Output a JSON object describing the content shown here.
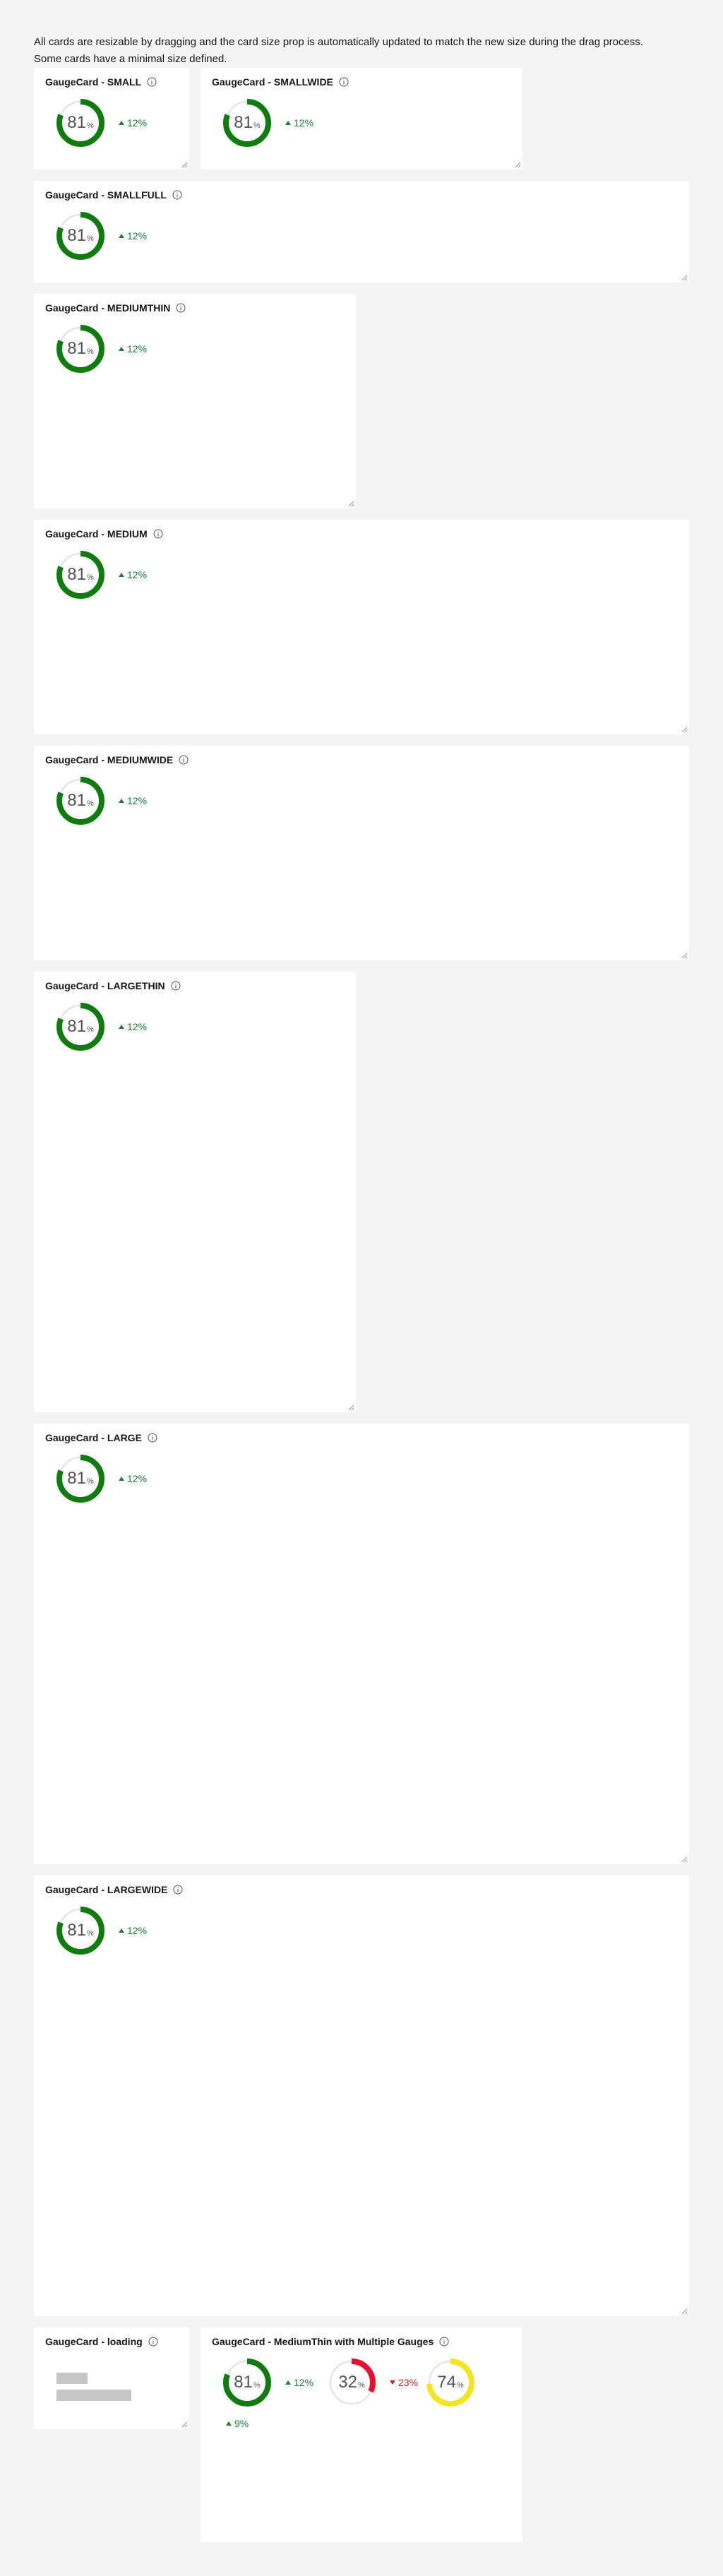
{
  "intro": "All cards are resizable by dragging and the card size prop is automatically updated to match the new size during the drag process. Some cards have a minimal size defined.",
  "colors": {
    "good": "#0e7d0e",
    "bad": "#da1e28",
    "warn": "#f1e32a",
    "track": "#e0e0e0"
  },
  "cards": {
    "small": {
      "title": "GaugeCard - SMALL",
      "gauge": {
        "value": "81",
        "unit": "%",
        "fraction": 0.81,
        "color": "#107c10"
      },
      "trend": "12%"
    },
    "smallwide": {
      "title": "GaugeCard - SMALLWIDE",
      "gauge": {
        "value": "81",
        "unit": "%",
        "fraction": 0.81,
        "color": "#107c10"
      },
      "trend": "12%"
    },
    "smallfull": {
      "title": "GaugeCard - SMALLFULL",
      "gauge": {
        "value": "81",
        "unit": "%",
        "fraction": 0.81,
        "color": "#107c10"
      },
      "trend": "12%"
    },
    "mediumthin": {
      "title": "GaugeCard - MEDIUMTHIN",
      "gauge": {
        "value": "81",
        "unit": "%",
        "fraction": 0.81,
        "color": "#107c10"
      },
      "trend": "12%"
    },
    "medium": {
      "title": "GaugeCard - MEDIUM",
      "gauge": {
        "value": "81",
        "unit": "%",
        "fraction": 0.81,
        "color": "#107c10"
      },
      "trend": "12%"
    },
    "mediumwide": {
      "title": "GaugeCard - MEDIUMWIDE",
      "gauge": {
        "value": "81",
        "unit": "%",
        "fraction": 0.81,
        "color": "#107c10"
      },
      "trend": "12%"
    },
    "largethin": {
      "title": "GaugeCard - LARGETHIN",
      "gauge": {
        "value": "81",
        "unit": "%",
        "fraction": 0.81,
        "color": "#107c10"
      },
      "trend": "12%"
    },
    "large": {
      "title": "GaugeCard - LARGE",
      "gauge": {
        "value": "81",
        "unit": "%",
        "fraction": 0.81,
        "color": "#107c10"
      },
      "trend": "12%"
    },
    "largewide": {
      "title": "GaugeCard - LARGEWIDE",
      "gauge": {
        "value": "81",
        "unit": "%",
        "fraction": 0.81,
        "color": "#107c10"
      },
      "trend": "12%"
    },
    "loading": {
      "title": "GaugeCard - loading"
    },
    "multi": {
      "title": "GaugeCard - MediumThin with Multiple Gauges",
      "gauges": [
        {
          "value": "81",
          "unit": "%",
          "fraction": 0.81,
          "color": "#107c10",
          "trend": "12%",
          "trend_dir": "up"
        },
        {
          "value": "32",
          "unit": "%",
          "fraction": 0.32,
          "color": "#e8112d",
          "trend": "23%",
          "trend_dir": "down"
        },
        {
          "value": "74",
          "unit": "%",
          "fraction": 0.74,
          "color": "#f5e520",
          "trend": "9%",
          "trend_dir": "up"
        }
      ]
    }
  }
}
